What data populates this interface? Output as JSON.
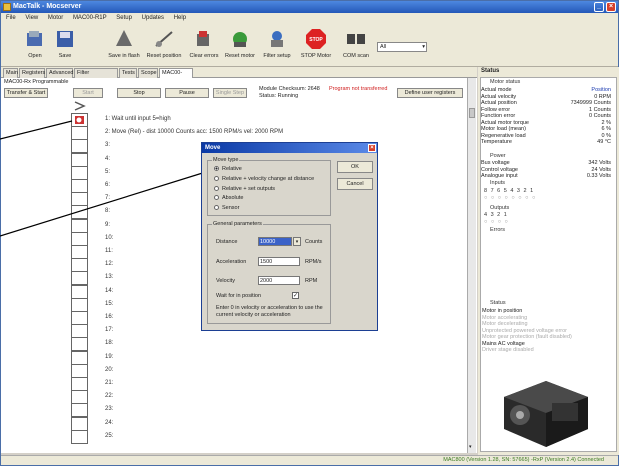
{
  "window": {
    "title": "MacTalk - Mocserver"
  },
  "menu": [
    "File",
    "View",
    "Motor",
    "MAC00-R1P",
    "Setup",
    "Updates",
    "Help"
  ],
  "toolbar": {
    "open": "Open",
    "save": "Save",
    "save_flash": "Save in flash",
    "reset_position": "Reset position",
    "clear_errors": "Clear errors",
    "reset_motor": "Reset motor",
    "filter_setup": "Filter setup",
    "stop_motor": "STOP Motor",
    "stop_sign": "STOP",
    "com_scan": "COM scan",
    "axis_value": "All"
  },
  "tabs": [
    "Main",
    "Registers",
    "Advanced",
    "Filter parameters",
    "Tests",
    "Scope",
    "MAC00-R1P"
  ],
  "program": {
    "caption": "MAC00-Rx Programmable",
    "transfer": "Transfer & Start",
    "start": "Start",
    "stop": "Stop",
    "pause": "Pause",
    "single_step": "Single Step",
    "checksum": "Module Checksum: 2648",
    "not_transferred": "Program not transferred",
    "status": "Status: Running",
    "define_registers": "Define user registers",
    "lines": [
      "1: Wait until input 5=high",
      "2: Move (Rel) - dist 10000 Counts acc: 1500 RPM/s vel: 2000 RPM",
      "3:",
      "4:",
      "5:",
      "6:",
      "7:",
      "8:",
      "9:",
      "10:",
      "11:",
      "12:",
      "13:",
      "14:",
      "15:",
      "16:",
      "17:",
      "18:",
      "19:",
      "20:",
      "21:",
      "22:",
      "23:",
      "24:",
      "25:"
    ]
  },
  "status_panel": {
    "title": "Status",
    "motor_status": "Motor status",
    "rows": [
      {
        "k": "Actual mode",
        "v": "Position"
      },
      {
        "k": "Actual velocity",
        "v": "0 RPM"
      },
      {
        "k": "Actual position",
        "v": "7349999 Counts"
      },
      {
        "k": "Follow error",
        "v": "1 Counts"
      },
      {
        "k": "Function error",
        "v": "0 Counts"
      },
      {
        "k": "Actual motor torque",
        "v": "2 %"
      },
      {
        "k": "Motor load (mean)",
        "v": "6 %"
      },
      {
        "k": "Regenerative load",
        "v": "0 %"
      },
      {
        "k": "Temperature",
        "v": "49 °C"
      }
    ],
    "power_label": "Power",
    "power_rows": [
      {
        "k": "Bus voltage",
        "v": "342 Volts"
      },
      {
        "k": "Control voltage",
        "v": "24 Volts"
      },
      {
        "k": "Analogue input",
        "v": "0.33 Volts"
      }
    ],
    "inputs_label": "Inputs",
    "inputs_digits": "8 7 6 5 4 3 2 1",
    "outputs_label": "Outputs",
    "outputs_digits": "4 3 2 1",
    "errors_label": "Errors",
    "status2_label": "Status",
    "status_items": [
      "Motor in position",
      "Motor accelerating",
      "Motor decelerating",
      "Unprotected powered voltage error",
      "Motor gear protection (fault disabled)",
      "Mains AC voltage",
      "Driver stage disabled"
    ],
    "status_items_active": [
      true,
      false,
      false,
      false,
      false,
      true,
      false
    ]
  },
  "statusbar": "MAC800 (Version 1.28, SN: 57665) -RxP (Version 2.4) Connected",
  "dialog": {
    "title": "Move",
    "move_type": "Move type",
    "options": [
      "Relative",
      "Relative + velocity change at distance",
      "Relative + set outputs",
      "Absolute",
      "Sensor"
    ],
    "selected": 0,
    "ok": "OK",
    "cancel": "Cancel",
    "general": "General parameters",
    "distance_label": "Distance",
    "distance_value": "10000",
    "distance_unit": "Counts",
    "accel_label": "Acceleration",
    "accel_value": "1500",
    "accel_unit": "RPM/s",
    "vel_label": "Velocity",
    "vel_value": "2000",
    "vel_unit": "RPM",
    "wait_label": "Wait for in position",
    "note": "Enter 0 in velocity or acceleration to use the current velocity or acceleration"
  }
}
